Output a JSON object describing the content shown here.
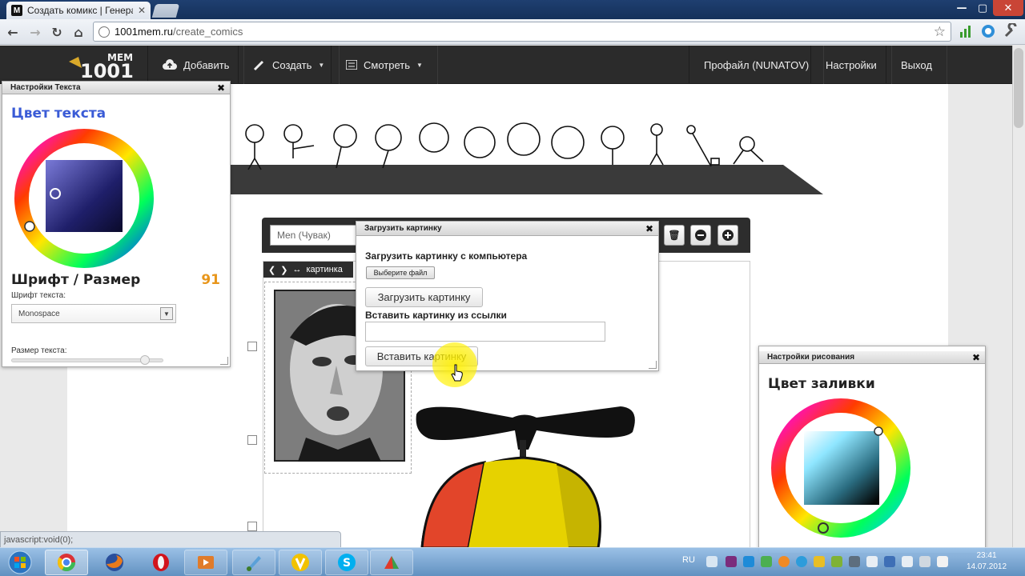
{
  "browser": {
    "tab_title": "Создать комикс | Генерат",
    "tab_close": "✕",
    "url_host": "1001mem.ru",
    "url_path": "/create_comics"
  },
  "window": {
    "minimize": "—",
    "maximize": "▢",
    "close": "✕"
  },
  "nav": {
    "logo_text": "MEM",
    "logo_num": "1001",
    "add": "Добавить",
    "create": "Создать",
    "view": "Смотреть",
    "profile": "Профайл (NUNATOV)",
    "settings": "Настройки",
    "logout": "Выход"
  },
  "text_panel": {
    "title": "Настройки Текста",
    "close": "✖",
    "color_heading": "Цвет текста",
    "font_heading": "Шрифт / Размер",
    "font_size_value": "91",
    "font_label": "Шрифт текста:",
    "font_value": "Monospace",
    "size_label": "Размер текста:",
    "size_fraction": 0.91
  },
  "editor": {
    "name_placeholder": "Men (Чувак)",
    "block_label": "картинка"
  },
  "upload_dialog": {
    "title": "Загрузить картинку",
    "close": "✖",
    "from_computer": "Загрузить картинку с компьютера",
    "choose_file": "Выберите файл",
    "upload_button": "Загрузить картинку",
    "from_url": "Вставить картинку из ссылки",
    "url_value": "",
    "insert_button": "Вставить картинку"
  },
  "draw_panel": {
    "title": "Настройки рисования",
    "close": "✖",
    "fill_heading": "Цвет заливки"
  },
  "status_text": "javascript:void(0);",
  "taskbar": {
    "lang": "RU",
    "time": "23:41",
    "date": "14.07.2012"
  },
  "colors": {
    "accent_blue": "#3a5bd6",
    "accent_orange": "#e8961b",
    "nav_bg": "#2b2b2b"
  }
}
